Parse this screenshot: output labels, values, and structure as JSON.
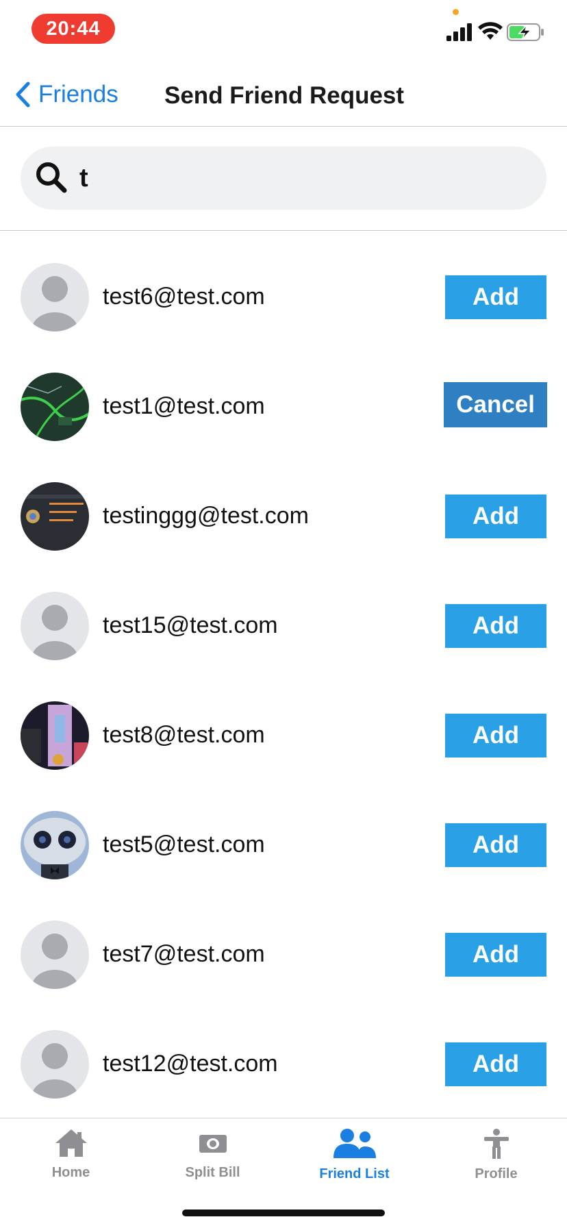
{
  "status_bar": {
    "time": "20:44"
  },
  "nav": {
    "back_label": "Friends",
    "title": "Send Friend Request"
  },
  "search": {
    "value": "t",
    "placeholder": ""
  },
  "users": [
    {
      "email": "test6@test.com",
      "action": "Add",
      "avatar": "default"
    },
    {
      "email": "test1@test.com",
      "action": "Cancel",
      "avatar": "map"
    },
    {
      "email": "testinggg@test.com",
      "action": "Add",
      "avatar": "dark-screenshot"
    },
    {
      "email": "test15@test.com",
      "action": "Add",
      "avatar": "default"
    },
    {
      "email": "test8@test.com",
      "action": "Add",
      "avatar": "game-art"
    },
    {
      "email": "test5@test.com",
      "action": "Add",
      "avatar": "robot"
    },
    {
      "email": "test7@test.com",
      "action": "Add",
      "avatar": "default"
    },
    {
      "email": "test12@test.com",
      "action": "Add",
      "avatar": "default"
    }
  ],
  "tabs": [
    {
      "label": "Home",
      "icon": "house-icon",
      "active": false
    },
    {
      "label": "Split Bill",
      "icon": "money-icon",
      "active": false
    },
    {
      "label": "Friend List",
      "icon": "people-icon",
      "active": true
    },
    {
      "label": "Profile",
      "icon": "person-icon",
      "active": false
    }
  ],
  "colors": {
    "accent": "#1a7fe0",
    "add_button": "#2aa1e6",
    "cancel_button": "#2f80c2",
    "time_pill": "#ef3b30"
  }
}
